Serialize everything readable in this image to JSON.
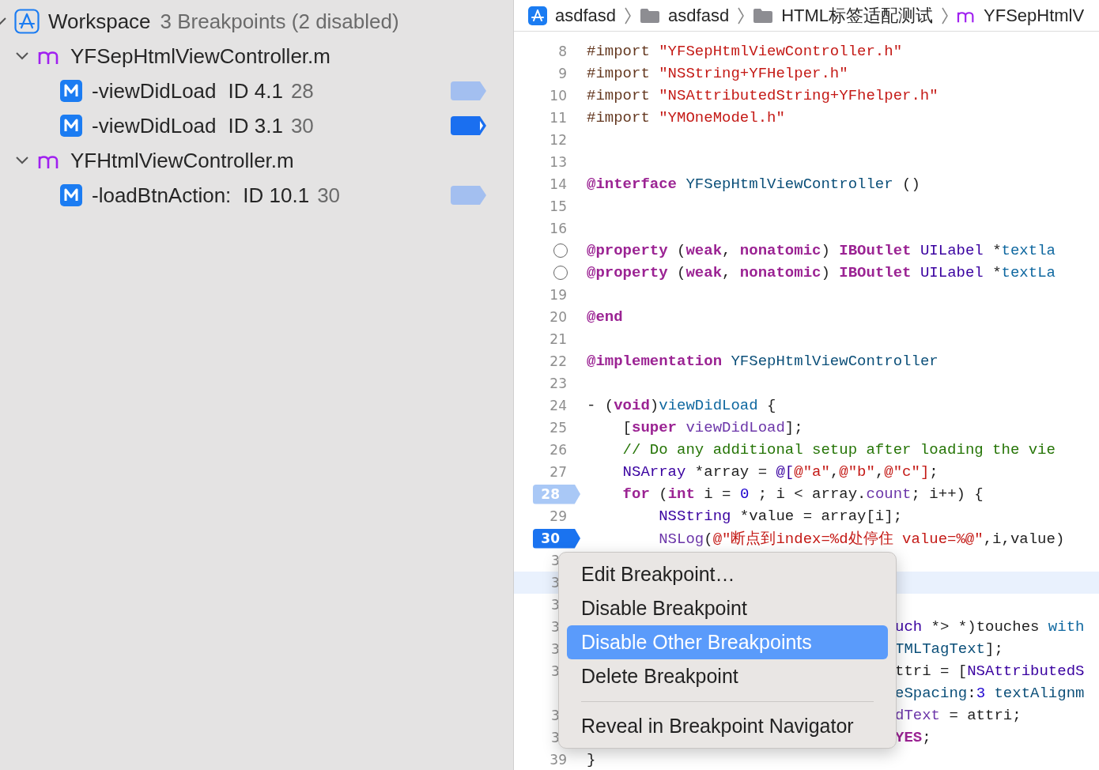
{
  "navigator": {
    "workspace": {
      "label": "Workspace",
      "summary": "3 Breakpoints (2 disabled)",
      "expanded": true,
      "files": [
        {
          "name": "YFSepHtmlViewController.m",
          "expanded": true,
          "breakpoints": [
            {
              "name": "-viewDidLoad",
              "id": "ID 4.1",
              "line": "28",
              "enabled": false
            },
            {
              "name": "-viewDidLoad",
              "id": "ID 3.1",
              "line": "30",
              "enabled": true
            }
          ]
        },
        {
          "name": "YFHtmlViewController.m",
          "expanded": true,
          "breakpoints": [
            {
              "name": "-loadBtnAction:",
              "id": "ID 10.1",
              "line": "30",
              "enabled": false
            }
          ]
        }
      ]
    }
  },
  "breadcrumb": [
    {
      "kind": "project",
      "label": "asdfasd"
    },
    {
      "kind": "folder",
      "label": "asdfasd"
    },
    {
      "kind": "folder",
      "label": "HTML标签适配测试"
    },
    {
      "kind": "file",
      "label": "YFSepHtmlV"
    }
  ],
  "editor": {
    "lines": [
      {
        "kind": "code",
        "number": "8",
        "current": false,
        "tokens": [
          {
            "kind": "preproc",
            "text": "#import "
          },
          {
            "kind": "string",
            "text": "\"YFSepHtmlViewController.h\""
          }
        ]
      },
      {
        "kind": "code",
        "number": "9",
        "current": false,
        "tokens": [
          {
            "kind": "preproc",
            "text": "#import "
          },
          {
            "kind": "string",
            "text": "\"NSString+YFHelper.h\""
          }
        ]
      },
      {
        "kind": "code",
        "number": "10",
        "current": false,
        "tokens": [
          {
            "kind": "preproc",
            "text": "#import "
          },
          {
            "kind": "string",
            "text": "\"NSAttributedString+YFhelper.h\""
          }
        ]
      },
      {
        "kind": "code",
        "number": "11",
        "current": false,
        "tokens": [
          {
            "kind": "preproc",
            "text": "#import "
          },
          {
            "kind": "string",
            "text": "\"YMOneModel.h\""
          }
        ]
      },
      {
        "kind": "code",
        "number": "12",
        "current": false
      },
      {
        "kind": "code",
        "number": "13",
        "current": false
      },
      {
        "kind": "code",
        "number": "14",
        "current": false,
        "tokens": [
          {
            "kind": "keyword",
            "text": "@interface "
          },
          {
            "kind": "type",
            "text": "YFSepHtmlViewController"
          },
          {
            "kind": "plain",
            "text": " ()"
          }
        ]
      },
      {
        "kind": "code",
        "number": "15",
        "current": false
      },
      {
        "kind": "code",
        "number": "16",
        "current": false
      },
      {
        "kind": "outlet",
        "current": false,
        "tokens": [
          {
            "kind": "keyword",
            "text": "@property"
          },
          {
            "kind": "plain",
            "text": " ("
          },
          {
            "kind": "keyword",
            "text": "weak"
          },
          {
            "kind": "plain",
            "text": ", "
          },
          {
            "kind": "keyword",
            "text": "nonatomic"
          },
          {
            "kind": "plain",
            "text": ") "
          },
          {
            "kind": "keyword",
            "text": "IBOutlet "
          },
          {
            "kind": "systype",
            "text": "UILabel"
          },
          {
            "kind": "plain",
            "text": " *"
          },
          {
            "kind": "decl",
            "text": "textla"
          }
        ]
      },
      {
        "kind": "outlet",
        "current": false,
        "tokens": [
          {
            "kind": "keyword",
            "text": "@property"
          },
          {
            "kind": "plain",
            "text": " ("
          },
          {
            "kind": "keyword",
            "text": "weak"
          },
          {
            "kind": "plain",
            "text": ", "
          },
          {
            "kind": "keyword",
            "text": "nonatomic"
          },
          {
            "kind": "plain",
            "text": ") "
          },
          {
            "kind": "keyword",
            "text": "IBOutlet "
          },
          {
            "kind": "systype",
            "text": "UILabel"
          },
          {
            "kind": "plain",
            "text": " *"
          },
          {
            "kind": "decl",
            "text": "textLa"
          }
        ]
      },
      {
        "kind": "code",
        "number": "19",
        "current": false
      },
      {
        "kind": "code",
        "number": "20",
        "current": false,
        "tokens": [
          {
            "kind": "keyword",
            "text": "@end"
          }
        ]
      },
      {
        "kind": "code",
        "number": "21",
        "current": false
      },
      {
        "kind": "code",
        "number": "22",
        "current": false,
        "tokens": [
          {
            "kind": "keyword",
            "text": "@implementation "
          },
          {
            "kind": "type",
            "text": "YFSepHtmlViewController"
          }
        ]
      },
      {
        "kind": "code",
        "number": "23",
        "current": false
      },
      {
        "kind": "code",
        "number": "24",
        "current": false,
        "tokens": [
          {
            "kind": "plain",
            "text": "- ("
          },
          {
            "kind": "keyword",
            "text": "void"
          },
          {
            "kind": "plain",
            "text": ")"
          },
          {
            "kind": "decl",
            "text": "viewDidLoad"
          },
          {
            "kind": "plain",
            "text": " {"
          }
        ]
      },
      {
        "kind": "code",
        "number": "25",
        "current": false,
        "tokens": [
          {
            "kind": "plain",
            "text": "    ["
          },
          {
            "kind": "keyword",
            "text": "super "
          },
          {
            "kind": "sysmethod",
            "text": "viewDidLoad"
          },
          {
            "kind": "plain",
            "text": "];"
          }
        ]
      },
      {
        "kind": "code",
        "number": "26",
        "current": false,
        "tokens": [
          {
            "kind": "comment",
            "text": "    // Do any additional setup after loading the vie"
          }
        ]
      },
      {
        "kind": "code",
        "number": "27",
        "current": false,
        "tokens": [
          {
            "kind": "systype",
            "text": "    NSArray"
          },
          {
            "kind": "plain",
            "text": " *array = "
          },
          {
            "kind": "systype",
            "text": "@["
          },
          {
            "kind": "string",
            "text": "@\"a\""
          },
          {
            "kind": "plain",
            "text": ","
          },
          {
            "kind": "string",
            "text": "@\"b\""
          },
          {
            "kind": "plain",
            "text": ","
          },
          {
            "kind": "string",
            "text": "@\"c\""
          },
          {
            "kind": "string",
            "text": "]"
          },
          {
            "kind": "plain",
            "text": ";"
          }
        ]
      },
      {
        "kind": "breakpoint",
        "number": "28",
        "enabled": false,
        "current": false,
        "tokens": [
          {
            "kind": "keyword",
            "text": "    for"
          },
          {
            "kind": "plain",
            "text": " ("
          },
          {
            "kind": "keyword",
            "text": "int"
          },
          {
            "kind": "plain",
            "text": " i = "
          },
          {
            "kind": "number",
            "text": "0"
          },
          {
            "kind": "plain",
            "text": " ; i < array."
          },
          {
            "kind": "sysmethod",
            "text": "count"
          },
          {
            "kind": "plain",
            "text": "; i++) {"
          }
        ]
      },
      {
        "kind": "code",
        "number": "29",
        "current": false,
        "tokens": [
          {
            "kind": "systype",
            "text": "        NSString"
          },
          {
            "kind": "plain",
            "text": " *value = array[i];"
          }
        ]
      },
      {
        "kind": "breakpoint",
        "number": "30",
        "enabled": true,
        "current": false,
        "tokens": [
          {
            "kind": "sysmethod",
            "text": "        NSLog"
          },
          {
            "kind": "plain",
            "text": "("
          },
          {
            "kind": "string",
            "text": "@\"断点到index=%d处停住 value=%@\""
          },
          {
            "kind": "plain",
            "text": ",i,value)"
          }
        ]
      },
      {
        "kind": "covered",
        "number": "3",
        "current": false
      },
      {
        "kind": "covered",
        "number": "3",
        "current": true
      },
      {
        "kind": "covered",
        "number": "3",
        "current": false
      },
      {
        "kind": "covered",
        "number": "3",
        "current": false,
        "tokens": [
          {
            "kind": "systype",
            "text": "uch"
          },
          {
            "kind": "plain",
            "text": " *> *)touches "
          },
          {
            "kind": "decl",
            "text": "with"
          }
        ]
      },
      {
        "kind": "covered",
        "number": "3",
        "current": false,
        "tokens": [
          {
            "kind": "type",
            "text": "TMLTagText"
          },
          {
            "kind": "plain",
            "text": "];"
          }
        ]
      },
      {
        "kind": "covered",
        "number": "3",
        "current": false,
        "tokens": [
          {
            "kind": "plain",
            "text": "ttri = ["
          },
          {
            "kind": "systype",
            "text": "NSAttributedS"
          }
        ]
      },
      {
        "kind": "wrap",
        "current": false,
        "tokens": [
          {
            "kind": "type",
            "text": "eSpacing"
          },
          {
            "kind": "plain",
            "text": ":"
          },
          {
            "kind": "number",
            "text": "3"
          },
          {
            "kind": "type",
            "text": " textAlignm"
          }
        ]
      },
      {
        "kind": "covered",
        "number": "3",
        "current": false,
        "tokens": [
          {
            "kind": "sysmethod",
            "text": "dText"
          },
          {
            "kind": "plain",
            "text": " = attri;"
          }
        ]
      },
      {
        "kind": "covered",
        "number": "3",
        "current": false,
        "tokens": [
          {
            "kind": "keyword",
            "text": "YES"
          },
          {
            "kind": "plain",
            "text": ";"
          }
        ]
      },
      {
        "kind": "code",
        "number": "39",
        "current": false,
        "tokens": [
          {
            "kind": "plain",
            "text": "}"
          }
        ]
      }
    ]
  },
  "context_menu": {
    "groups": [
      [
        {
          "label": "Edit Breakpoint…",
          "selected": false
        },
        {
          "label": "Disable Breakpoint",
          "selected": false
        },
        {
          "label": "Disable Other Breakpoints",
          "selected": true
        },
        {
          "label": "Delete Breakpoint",
          "selected": false
        }
      ],
      [
        {
          "label": "Reveal in Breakpoint Navigator",
          "selected": false
        }
      ]
    ]
  }
}
